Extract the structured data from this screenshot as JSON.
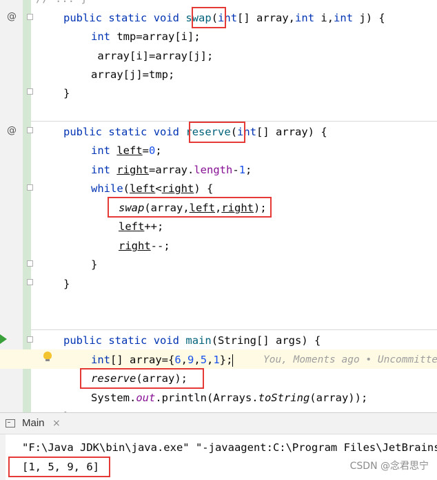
{
  "editor": {
    "top_fragment": "// ... }",
    "swap": {
      "sig": [
        "public",
        "static",
        "void",
        "swap",
        "(",
        "int",
        "[] array,",
        "int",
        " i,",
        "int",
        " j) {"
      ],
      "line1": [
        "int",
        " tmp=array[i];"
      ],
      "line2": " array[i]=array[j];",
      "line3": "array[j]=tmp;",
      "close": "}"
    },
    "reserve": {
      "sig": [
        "public",
        "static",
        "void",
        "reserve",
        "(",
        "int",
        "[] array) {"
      ],
      "l1": [
        "int",
        "left",
        "=",
        "0",
        ";"
      ],
      "l2": [
        "int",
        "right",
        "=array.",
        "length",
        "-",
        "1",
        ";"
      ],
      "l3": [
        "while",
        "(",
        "left",
        "<",
        "right",
        ") {"
      ],
      "l4": [
        "swap",
        "(array,",
        "left",
        ",",
        "right",
        ");"
      ],
      "l5": [
        "left",
        "++;"
      ],
      "l6": [
        "right",
        "--;"
      ],
      "close_inner": "}",
      "close": "}"
    },
    "main": {
      "sig": [
        "public",
        "static",
        "void",
        "main",
        "(String[] args) {"
      ],
      "l1": [
        "int",
        "[] array={",
        "6",
        ",",
        "9",
        ",",
        "5",
        ",",
        "1",
        "};"
      ],
      "hint": "You, Moments ago • Uncommitted changes",
      "l2": [
        "reserve",
        "(array);"
      ],
      "l3": [
        "System.",
        "out",
        ".println(Arrays.",
        "toString",
        "(array));"
      ],
      "close": "}"
    },
    "gutter_icons": [
      "@",
      "@"
    ]
  },
  "run_panel": {
    "tab_label": "Main",
    "close_glyph": "×",
    "command": "\"F:\\Java JDK\\bin\\java.exe\" \"-javaagent:C:\\Program Files\\JetBrains",
    "output": "[1, 5, 9, 6]"
  },
  "watermark": "CSDN @念君思宁",
  "colors": {
    "keyword": "#0033b3",
    "method": "#00627a",
    "number": "#1750eb",
    "field": "#871094",
    "highlight_box": "#e53935"
  }
}
